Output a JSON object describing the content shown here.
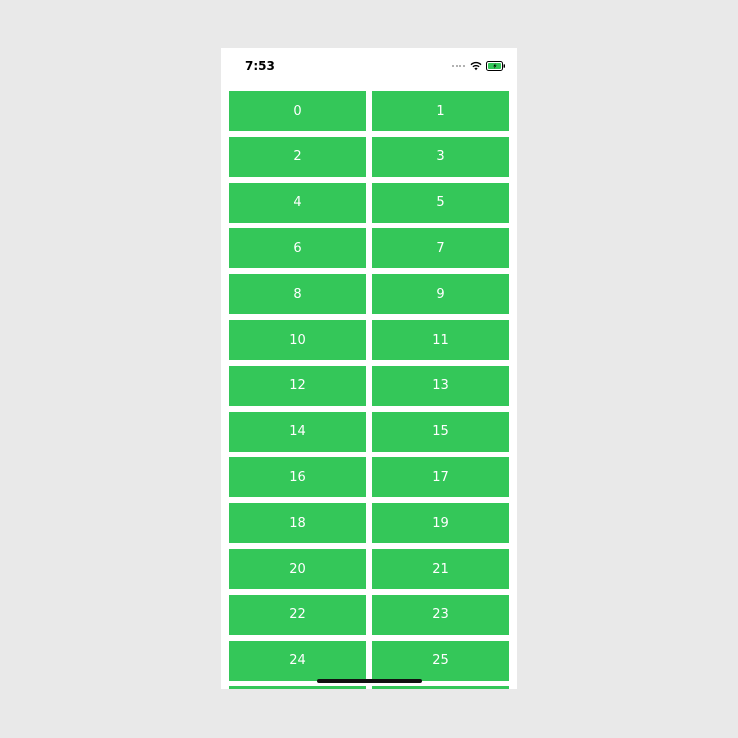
{
  "status_bar": {
    "time": "7:53",
    "icons": [
      "cellular-signal-icon",
      "wifi-icon",
      "battery-charging-icon"
    ],
    "battery_color": "#34c759"
  },
  "grid": {
    "cell_color": "#34c759",
    "text_color": "#ffffff",
    "items": [
      "0",
      "1",
      "2",
      "3",
      "4",
      "5",
      "6",
      "7",
      "8",
      "9",
      "10",
      "11",
      "12",
      "13",
      "14",
      "15",
      "16",
      "17",
      "18",
      "19",
      "20",
      "21",
      "22",
      "23",
      "24",
      "25",
      "",
      ""
    ]
  }
}
